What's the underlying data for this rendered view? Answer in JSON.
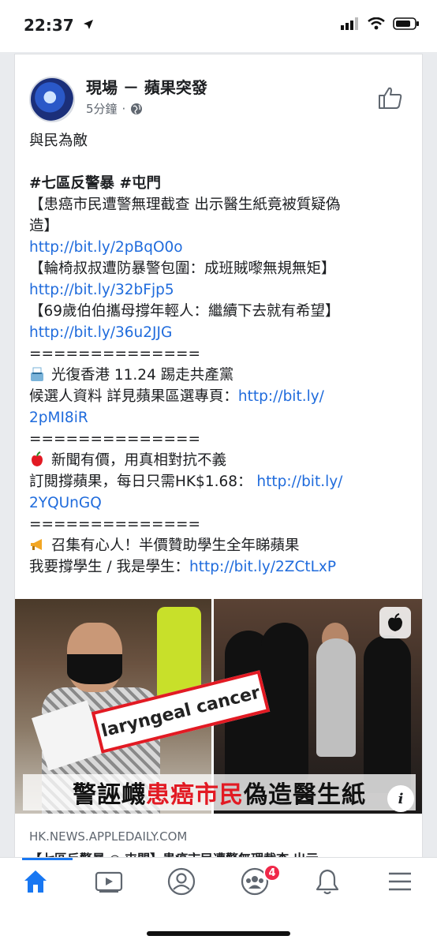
{
  "status_bar": {
    "time": "22:37"
  },
  "post": {
    "page_name": "現場 － 蘋果突發",
    "time_ago": "5分鐘",
    "meta_sep": "·",
    "lines": [
      {
        "text": "與民為敵",
        "kind": "text"
      },
      {
        "text": "",
        "kind": "blank"
      },
      {
        "text": "#七區反警暴 #屯門",
        "kind": "bold"
      },
      {
        "text": "【患癌市民遭警無理截查 出示醫生紙竟被質疑偽",
        "kind": "text"
      },
      {
        "text": "造】",
        "kind": "text"
      },
      {
        "text": "http://bit.ly/2pBqO0o",
        "kind": "link"
      },
      {
        "text": "【輪椅叔叔遭防暴警包圍：成班賊嚟無規無矩】",
        "kind": "text"
      },
      {
        "text": "http://bit.ly/32bFjp5",
        "kind": "link"
      },
      {
        "text": "【69歲伯伯攜母撐年輕人：繼續下去就有希望】",
        "kind": "text"
      },
      {
        "text": "http://bit.ly/36u2JJG",
        "kind": "link"
      },
      {
        "text": "==============",
        "kind": "text"
      },
      {
        "text": "光復香港 11.24 踢走共產黨",
        "kind": "emoji",
        "emoji": "ballot-box"
      },
      {
        "text": "候選人資料 詳見蘋果區選專頁：",
        "link": "http://bit.ly/",
        "kind": "mixed"
      },
      {
        "text": "2pMI8iR",
        "kind": "link"
      },
      {
        "text": "==============",
        "kind": "text"
      },
      {
        "text": "新聞有價，用真相對抗不義",
        "kind": "emoji",
        "emoji": "apple"
      },
      {
        "text": "訂閱撐蘋果，每日只需HK$1.68： ",
        "link": "http://bit.ly/",
        "kind": "mixed"
      },
      {
        "text": "2YQUnGQ",
        "kind": "link"
      },
      {
        "text": "==============",
        "kind": "text"
      },
      {
        "text": "召集有心人！半價贊助學生全年睇蘋果",
        "kind": "emoji",
        "emoji": "megaphone"
      },
      {
        "text": "我要撐學生 / 我是學生：",
        "link": "http://bit.ly/2ZCtLxP",
        "kind": "mixed"
      }
    ]
  },
  "media": {
    "label_text": "laryngeal cancer",
    "caption_black_1": "警誣衊",
    "caption_red": "患癌市民",
    "caption_black_2": "偽造醫生紙",
    "info_glyph": "i"
  },
  "link_preview": {
    "domain": "HK.NEWS.APPLEDAILY.COM",
    "title": "【七區反警暴 ◉ 屯門】患癌市民遭警無理截查 出示"
  },
  "bottom_nav": {
    "items": [
      "home-icon",
      "watch-icon",
      "profile-icon",
      "groups-icon",
      "notifications-icon",
      "menu-icon"
    ],
    "groups_badge": "4",
    "active_color": "#1877f2"
  }
}
